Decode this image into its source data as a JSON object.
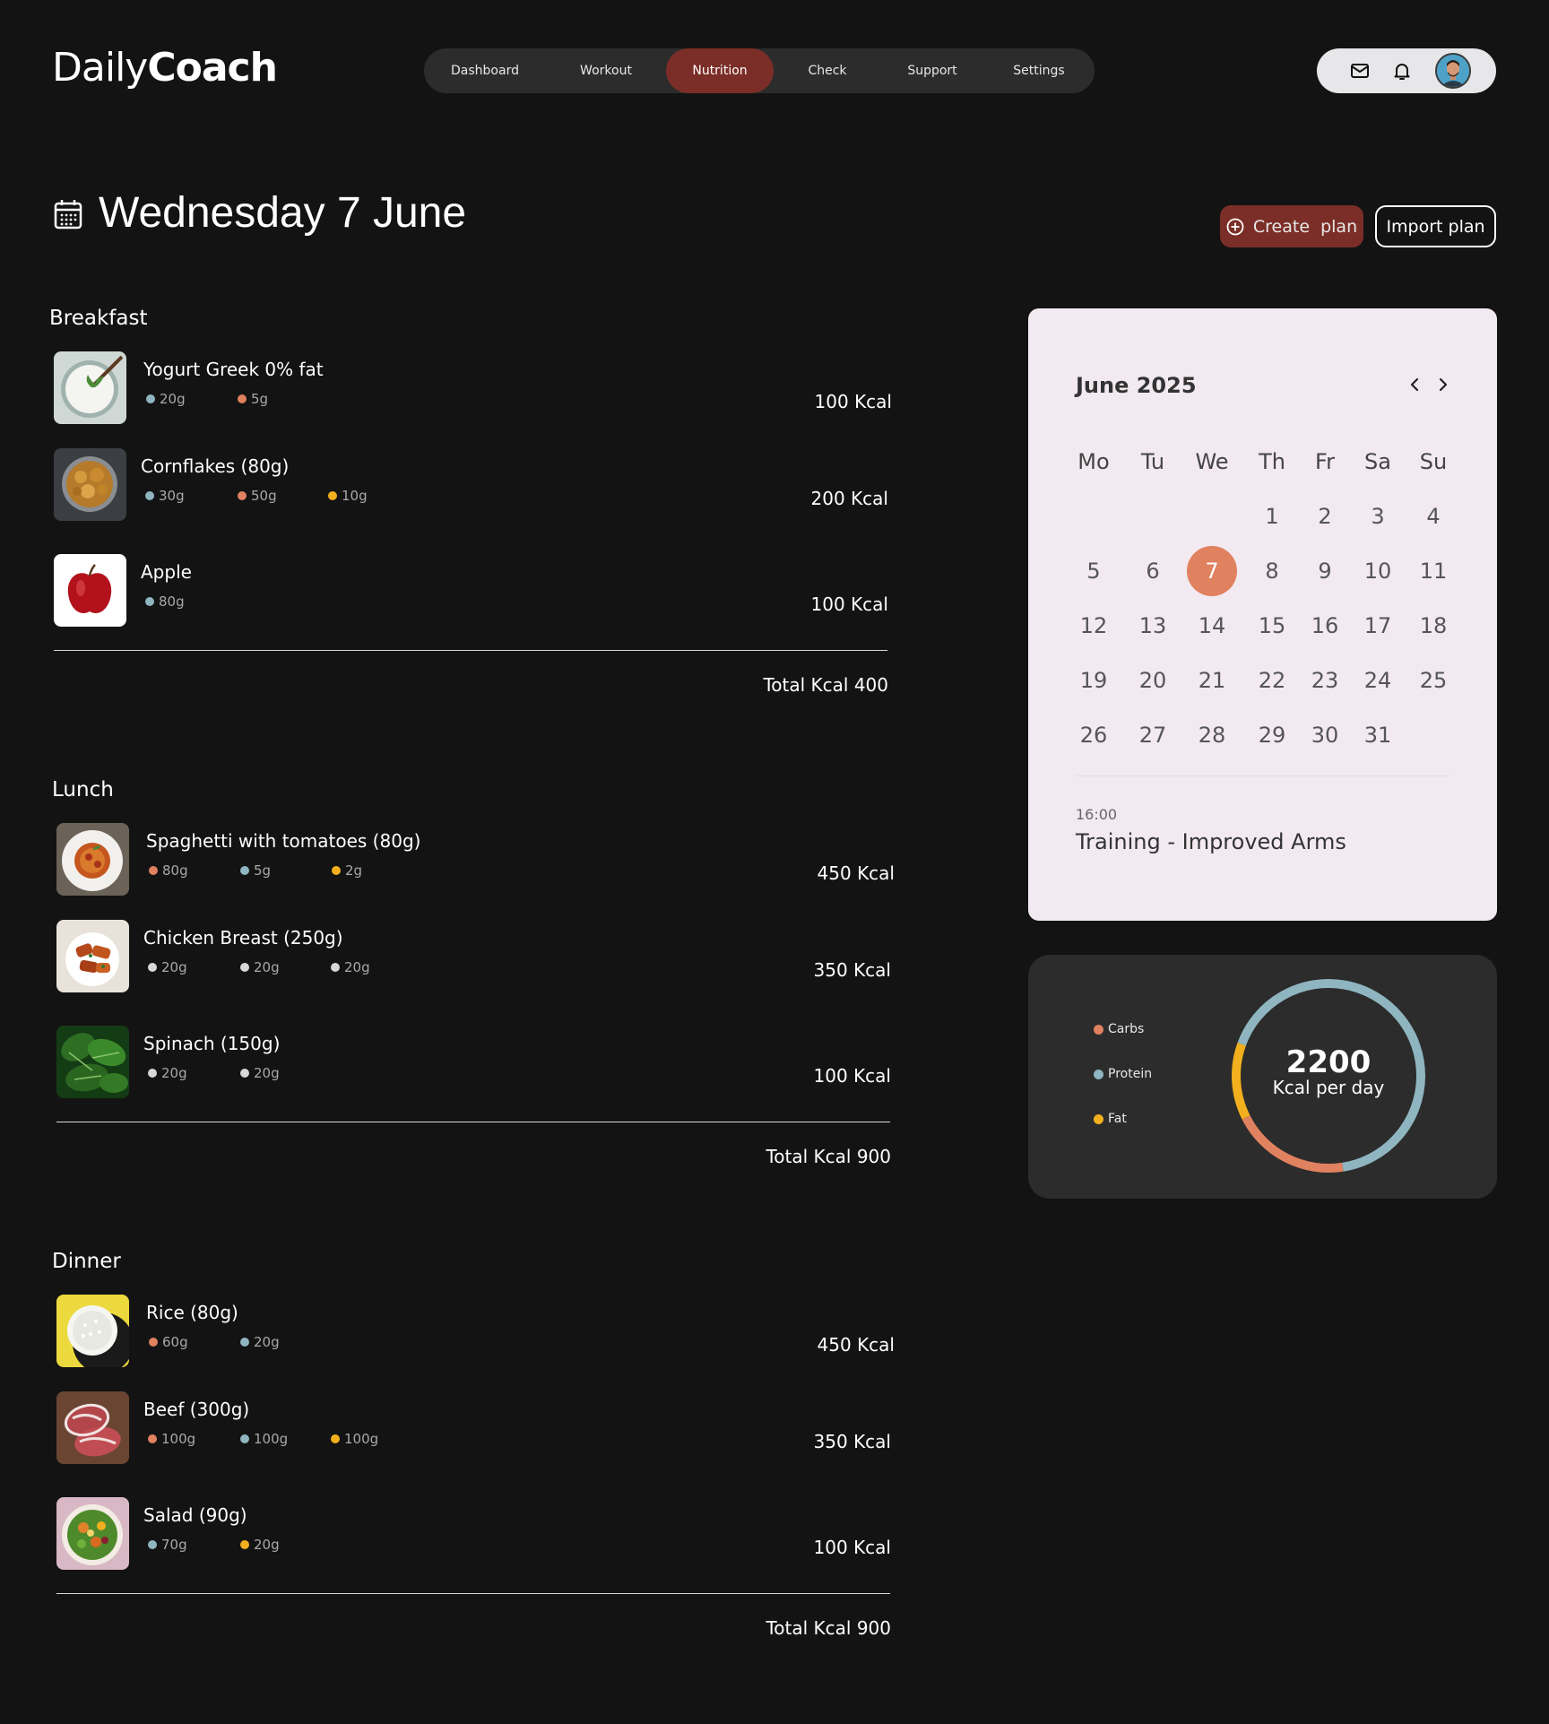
{
  "brand": {
    "light": "Daily",
    "bold": "Coach"
  },
  "nav": {
    "items": [
      {
        "label": "Dashboard",
        "active": false
      },
      {
        "label": "Workout",
        "active": false
      },
      {
        "label": "Nutrition",
        "active": true
      },
      {
        "label": "Check",
        "active": false
      },
      {
        "label": "Support",
        "active": false
      },
      {
        "label": "Settings",
        "active": false
      }
    ]
  },
  "header_icons": [
    "mail-icon",
    "bell-icon",
    "avatar"
  ],
  "page": {
    "date_title": "Wednesday 7 June",
    "create_plan_label": "Create  plan",
    "import_plan_label": "Import plan"
  },
  "colors": {
    "accent": "#7b2e27",
    "carbs": "#e0815f",
    "protein": "#8fb6c0",
    "fat": "#f2b01e",
    "neutral_macro": "#d8d8d8",
    "calendar_bg": "#f2eaf0"
  },
  "meals": [
    {
      "title": "Breakfast",
      "items": [
        {
          "name": "Yogurt Greek 0% fat",
          "image": "yogurt-image",
          "kcal": "100 Kcal",
          "macros": [
            {
              "value": "20g",
              "type": "protein"
            },
            {
              "value": "5g",
              "type": "carbs"
            }
          ]
        },
        {
          "name": "Cornflakes (80g)",
          "image": "cornflakes-image",
          "kcal": "200 Kcal",
          "macros": [
            {
              "value": "30g",
              "type": "protein"
            },
            {
              "value": "50g",
              "type": "carbs"
            },
            {
              "value": "10g",
              "type": "fat"
            }
          ]
        },
        {
          "name": "Apple",
          "image": "apple-image",
          "kcal": "100 Kcal",
          "macros": [
            {
              "value": "80g",
              "type": "protein"
            }
          ]
        }
      ],
      "total": "Total Kcal 400"
    },
    {
      "title": "Lunch",
      "items": [
        {
          "name": "Spaghetti with tomatoes (80g)",
          "image": "spaghetti-image",
          "kcal": "450 Kcal",
          "macros": [
            {
              "value": "80g",
              "type": "carbs"
            },
            {
              "value": "5g",
              "type": "protein"
            },
            {
              "value": "2g",
              "type": "fat"
            }
          ]
        },
        {
          "name": "Chicken Breast (250g)",
          "image": "chicken-image",
          "kcal": "350 Kcal",
          "macros": [
            {
              "value": "20g",
              "type": "neutral"
            },
            {
              "value": "20g",
              "type": "neutral"
            },
            {
              "value": "20g",
              "type": "neutral"
            }
          ]
        },
        {
          "name": "Spinach (150g)",
          "image": "spinach-image",
          "kcal": "100 Kcal",
          "macros": [
            {
              "value": "20g",
              "type": "neutral"
            },
            {
              "value": "20g",
              "type": "neutral"
            }
          ]
        }
      ],
      "total": "Total Kcal 900"
    },
    {
      "title": "Dinner",
      "items": [
        {
          "name": "Rice (80g)",
          "image": "rice-image",
          "kcal": "450 Kcal",
          "macros": [
            {
              "value": "60g",
              "type": "carbs"
            },
            {
              "value": "20g",
              "type": "protein"
            }
          ]
        },
        {
          "name": "Beef (300g)",
          "image": "beef-image",
          "kcal": "350 Kcal",
          "macros": [
            {
              "value": "100g",
              "type": "carbs"
            },
            {
              "value": "100g",
              "type": "protein"
            },
            {
              "value": "100g",
              "type": "fat"
            }
          ]
        },
        {
          "name": "Salad (90g)",
          "image": "salad-image",
          "kcal": "100 Kcal",
          "macros": [
            {
              "value": "70g",
              "type": "protein"
            },
            {
              "value": "20g",
              "type": "fat"
            }
          ]
        }
      ],
      "total": "Total Kcal 900"
    }
  ],
  "calendar": {
    "month_label": "June 2025",
    "weekdays": [
      "Mo",
      "Tu",
      "We",
      "Th",
      "Fr",
      "Sa",
      "Su"
    ],
    "first_weekday_index": 3,
    "days_in_month": 31,
    "selected_day": 7,
    "event": {
      "time": "16:00",
      "title": "Training - Improved Arms"
    }
  },
  "kcal_summary": {
    "value": "2200",
    "label": "Kcal per day",
    "legend": [
      {
        "label": "Carbs",
        "type": "carbs"
      },
      {
        "label": "Protein",
        "type": "protein"
      },
      {
        "label": "Fat",
        "type": "fat"
      }
    ],
    "ring_shares": {
      "protein": 0.67,
      "carbs": 0.2,
      "fat": 0.13
    }
  }
}
